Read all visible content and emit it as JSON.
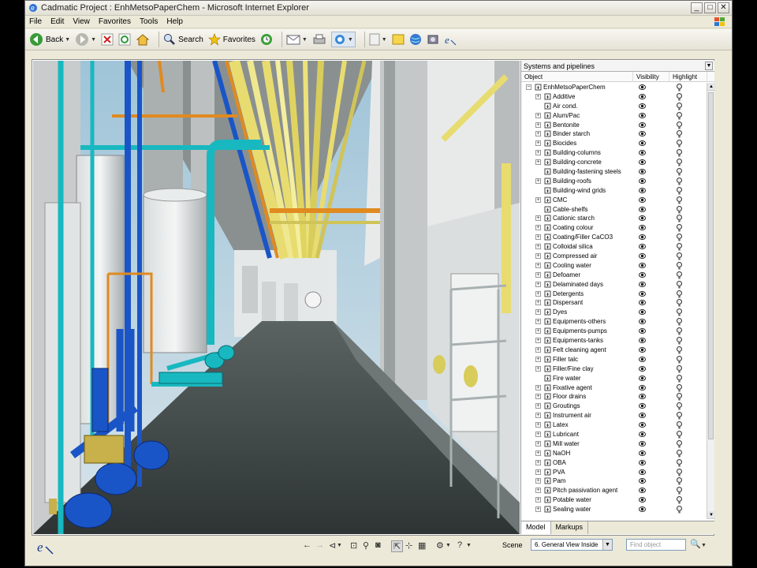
{
  "window": {
    "title": "Cadmatic Project : EnhMetsoPaperChem - Microsoft Internet Explorer",
    "controls": [
      "_",
      "□",
      "✕"
    ]
  },
  "menu": [
    "File",
    "Edit",
    "View",
    "Favorites",
    "Tools",
    "Help"
  ],
  "toolbar": {
    "back": "Back",
    "search": "Search",
    "favorites": "Favorites"
  },
  "panel": {
    "header": "Systems and pipelines",
    "columns": {
      "object": "Object",
      "visibility": "Visibility",
      "highlight": "Highlight"
    },
    "root": "EnhMetsoPaperChem",
    "items": [
      {
        "label": "Additive",
        "exp": true
      },
      {
        "label": "Air cond.",
        "exp": false
      },
      {
        "label": "Alum/Pac",
        "exp": true
      },
      {
        "label": "Bentonite",
        "exp": true
      },
      {
        "label": "Binder starch",
        "exp": true
      },
      {
        "label": "Biocides",
        "exp": true
      },
      {
        "label": "Building-columns",
        "exp": true
      },
      {
        "label": "Building-concrete",
        "exp": true
      },
      {
        "label": "Building-fastening steels",
        "exp": false
      },
      {
        "label": "Building-roofs",
        "exp": true
      },
      {
        "label": "Building-wind grids",
        "exp": false
      },
      {
        "label": "CMC",
        "exp": true
      },
      {
        "label": "Cable-shelfs",
        "exp": false
      },
      {
        "label": "Cationic starch",
        "exp": true
      },
      {
        "label": "Coating colour",
        "exp": true
      },
      {
        "label": "Coating/Filler CaCO3",
        "exp": true
      },
      {
        "label": "Colloidal silica",
        "exp": true
      },
      {
        "label": "Compressed air",
        "exp": true
      },
      {
        "label": "Cooling water",
        "exp": true
      },
      {
        "label": "Defoamer",
        "exp": true
      },
      {
        "label": "Delaminated days",
        "exp": true
      },
      {
        "label": "Detergents",
        "exp": true
      },
      {
        "label": "Dispersant",
        "exp": true
      },
      {
        "label": "Dyes",
        "exp": true
      },
      {
        "label": "Equipments-others",
        "exp": true
      },
      {
        "label": "Equipments-pumps",
        "exp": true
      },
      {
        "label": "Equipments-tanks",
        "exp": true
      },
      {
        "label": "Felt cleaning agent",
        "exp": true
      },
      {
        "label": "Filler talc",
        "exp": true
      },
      {
        "label": "Filler/Fine clay",
        "exp": true
      },
      {
        "label": "Fire water",
        "exp": false
      },
      {
        "label": "Fixative agent",
        "exp": true
      },
      {
        "label": "Floor drains",
        "exp": true
      },
      {
        "label": "Groutings",
        "exp": true
      },
      {
        "label": "Instrument air",
        "exp": true
      },
      {
        "label": "Latex",
        "exp": true
      },
      {
        "label": "Lubricant",
        "exp": true
      },
      {
        "label": "Mill water",
        "exp": true
      },
      {
        "label": "NaOH",
        "exp": true
      },
      {
        "label": "OBA",
        "exp": true
      },
      {
        "label": "PVA",
        "exp": true
      },
      {
        "label": "Pam",
        "exp": true
      },
      {
        "label": "Pitch passivation agent",
        "exp": true
      },
      {
        "label": "Potable water",
        "exp": true
      },
      {
        "label": "Sealing water",
        "exp": true
      }
    ],
    "tabs": [
      "Model",
      "Markups"
    ]
  },
  "bottom": {
    "scene_label": "Scene",
    "scene_value": "6. General View Inside",
    "find_placeholder": "Find object"
  },
  "colors": {
    "pipe_cyan": "#18b8c0",
    "pipe_yellow": "#e8dc70",
    "pipe_blue": "#1a55c8",
    "pipe_orange": "#e08a20",
    "floor": "#3a4040"
  }
}
